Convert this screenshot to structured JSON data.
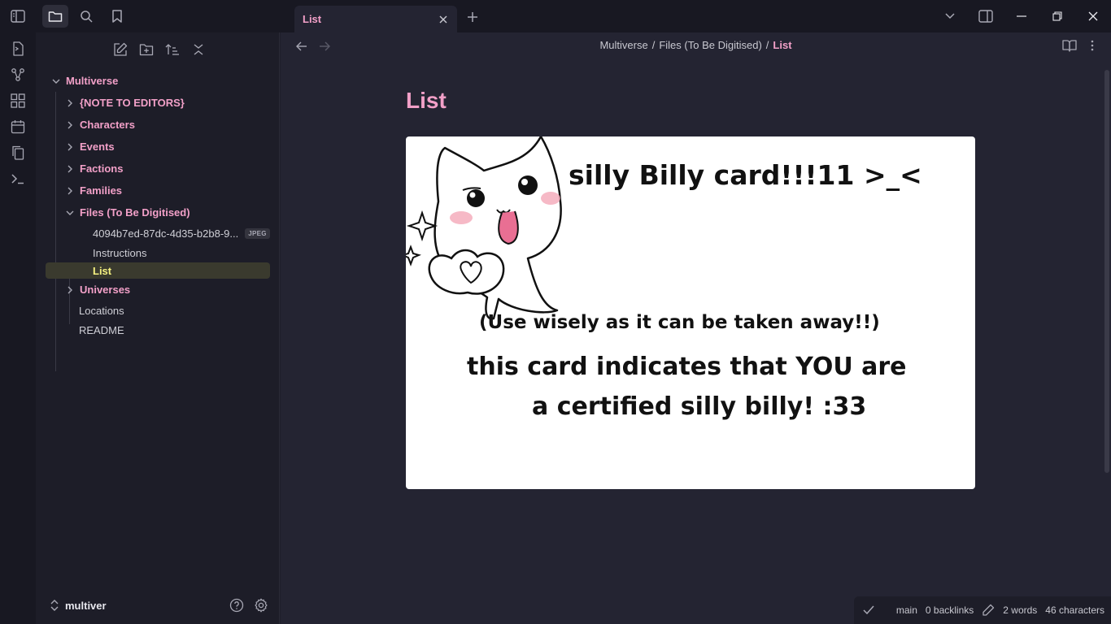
{
  "titlebar": {
    "tab_title": "List"
  },
  "sidebar": {
    "root": "Multiverse",
    "items": [
      {
        "label": "{NOTE TO EDITORS}"
      },
      {
        "label": "Characters"
      },
      {
        "label": "Events"
      },
      {
        "label": "Factions"
      },
      {
        "label": "Families"
      },
      {
        "label": "Files (To Be Digitised)"
      },
      {
        "label": "4094b7ed-87dc-4d35-b2b8-9...",
        "badge": "JPEG"
      },
      {
        "label": "Instructions"
      },
      {
        "label": "List"
      },
      {
        "label": "Universes"
      },
      {
        "label": "Locations"
      },
      {
        "label": "README"
      }
    ],
    "vault_name": "multiver"
  },
  "main": {
    "breadcrumb": [
      "Multiverse",
      "Files (To Be Digitised)",
      "List"
    ],
    "separator": "/",
    "note_title": "List",
    "card": {
      "line1": "silly Billy card!!!11 >_<",
      "line2": "(Use wisely as it can be taken away!!)",
      "line3": "this card indicates that YOU are",
      "line4": "a certified silly billy! :33"
    }
  },
  "status": {
    "branch": "main",
    "backlinks": "0 backlinks",
    "words": "2 words",
    "characters": "46 characters"
  },
  "colors": {
    "accent": "#f2a0c8",
    "active_file": "#f4f080",
    "background": "#242432"
  }
}
